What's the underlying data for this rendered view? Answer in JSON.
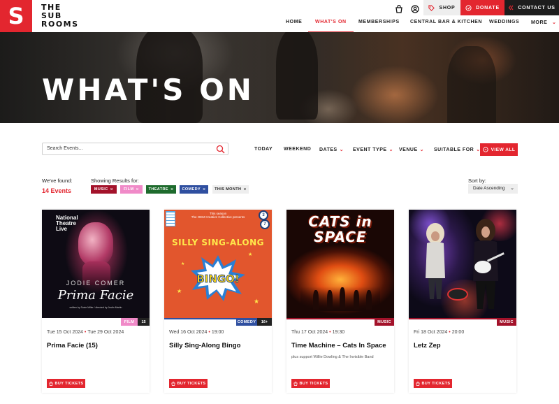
{
  "brand": {
    "logo_letter": "S",
    "wordmark": [
      "THE",
      "SUB",
      "ROOMS"
    ],
    "accent": "#e3262f"
  },
  "utility": {
    "shop": "SHOP",
    "donate": "DONATE",
    "contact": "CONTACT US"
  },
  "nav": {
    "items": [
      "HOME",
      "WHAT'S ON",
      "MEMBERSHIPS",
      "CENTRAL BAR & KITCHEN",
      "WEDDINGS",
      "MORE"
    ],
    "active": "WHAT'S ON"
  },
  "hero": {
    "title": "WHAT'S ON"
  },
  "filters": {
    "search_placeholder": "Search Events...",
    "today": "TODAY",
    "weekend": "WEEKEND",
    "dates": "DATES",
    "event_type": "EVENT TYPE",
    "venue": "VENUE",
    "suitable_for": "SUITABLE FOR",
    "view_all": "VIEW ALL"
  },
  "results": {
    "found_label": "We've found:",
    "found_count": "14 Events",
    "showing_label": "Showing Results for:",
    "tags": [
      {
        "label": "MUSIC",
        "color": "#a3122a"
      },
      {
        "label": "FILM",
        "color": "#f08ac8"
      },
      {
        "label": "THEATRE",
        "color": "#1e6b2d"
      },
      {
        "label": "COMEDY",
        "color": "#2f4fa0"
      },
      {
        "label": "THIS MONTH",
        "color": "#eeeeee"
      }
    ],
    "sort_label": "Sort by:",
    "sort_value": "Date Ascending"
  },
  "events": [
    {
      "date": "Tue 15 Oct 2024",
      "date_end": "Tue 29 Oct 2024",
      "title": "Prima Facie (15)",
      "subtitle": "",
      "category": "FILM",
      "category_color": "#f08ac8",
      "age": "15",
      "buy": "BUY TICKETS",
      "poster": {
        "brand_lines": [
          "National",
          "Theatre",
          "Live"
        ],
        "actor": "JODIE COMER",
        "title": "Prima Facie",
        "credit": "written by Suzie Miller / directed by Justin Martin"
      }
    },
    {
      "date": "Wed 16 Oct 2024",
      "time": "19:00",
      "title": "Silly Sing-Along Bingo",
      "subtitle": "",
      "category": "COMEDY",
      "category_color": "#2f4fa0",
      "age": "16+",
      "buy": "BUY TICKETS",
      "poster": {
        "pre_lines": [
          "This season",
          "The OEM Creative Collective presents"
        ],
        "heading": "SILLY SING-ALONG",
        "burst": "BINGO!",
        "balls": [
          "3",
          "7"
        ]
      }
    },
    {
      "date": "Thu 17 Oct 2024",
      "time": "19:30",
      "title": "Time Machine – Cats In Space",
      "subtitle": "plus support Willie Dowling & The Invisible Band",
      "category": "MUSIC",
      "category_color": "#a3122a",
      "buy": "BUY TICKETS",
      "poster": {
        "lines": [
          "CATS in",
          "SPACE"
        ]
      }
    },
    {
      "date": "Fri 18 Oct 2024",
      "time": "20:00",
      "title": "Letz Zep",
      "subtitle": "",
      "category": "MUSIC",
      "category_color": "#a3122a",
      "buy": "BUY TICKETS"
    }
  ]
}
